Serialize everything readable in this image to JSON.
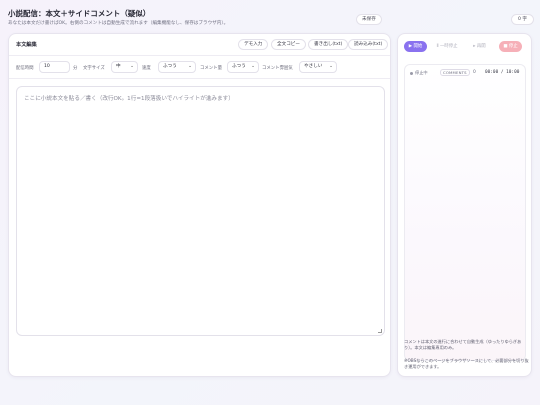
{
  "header": {
    "title": "小説配信：本文＋サイドコメント（疑似）",
    "subtitle": "あなたは本文だけ書けばOK。右側のコメントは自動生成で流れます（編集機能なし、保存はブラウザ内）。",
    "save_status": "未保存",
    "char_count": "0 字"
  },
  "editor_panel": {
    "title": "本文編集",
    "buttons": {
      "demo": "デモ入力",
      "copy_all": "全文コピー",
      "export": "書き出し(txt)",
      "import": "読み込み(txt)"
    },
    "settings": {
      "duration_label": "配信時間",
      "duration_value": "10",
      "duration_unit": "分",
      "font_size_label": "文字サイズ",
      "font_size_value": "中",
      "speed_label": "速度",
      "speed_value": "ふつう",
      "comment_amount_label": "コメント量",
      "comment_amount_value": "ふつう",
      "comment_mood_label": "コメント雰囲気",
      "comment_mood_value": "やさしい"
    },
    "editor_placeholder": "ここに小説本文を貼る／書く（改行OK。1行=1段落扱いでハイライトが進みます）"
  },
  "comment_panel": {
    "play_label": "▶ 開始",
    "pause_label": "Ⅱ 一時停止",
    "resume_label": "▸ 再開",
    "stop_label": "■ 停止",
    "live_label": "停止中",
    "comments_badge": "COMMENTS",
    "comment_count": "0",
    "timer": "00:00 / 10:00",
    "note_1": "コメントは本文の進行に合わせて自動生成（ゆったりゆらぎあり）。本文は編集専用のみ。",
    "note_2": "※OBSならこのページをブラウザソースにして、必要部分を切り抜き運用ができます。"
  },
  "colors": {
    "accent": "#8a72ef",
    "stop": "#f6b0b8",
    "border": "#e3e1ea"
  }
}
